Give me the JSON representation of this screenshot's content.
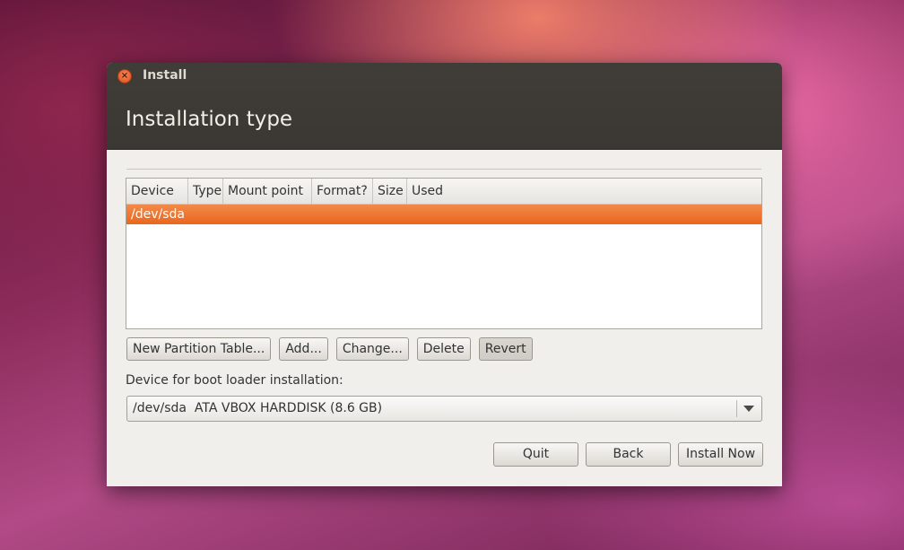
{
  "window": {
    "title": "Install",
    "close_icon": "close-icon",
    "page_title": "Installation type"
  },
  "table": {
    "columns": [
      "Device",
      "Type",
      "Mount point",
      "Format?",
      "Size",
      "Used"
    ],
    "rows": [
      {
        "device": "/dev/sda",
        "selected": true
      }
    ],
    "selected_color": "#e9661d"
  },
  "partition_buttons": {
    "new_table": "New Partition Table...",
    "add": "Add...",
    "change": "Change...",
    "delete": "Delete",
    "revert": "Revert"
  },
  "bootloader": {
    "label": "Device for boot loader installation:",
    "selected": "/dev/sda  ATA VBOX HARDDISK (8.6 GB)"
  },
  "actions": {
    "quit": "Quit",
    "back": "Back",
    "install_now": "Install Now"
  }
}
